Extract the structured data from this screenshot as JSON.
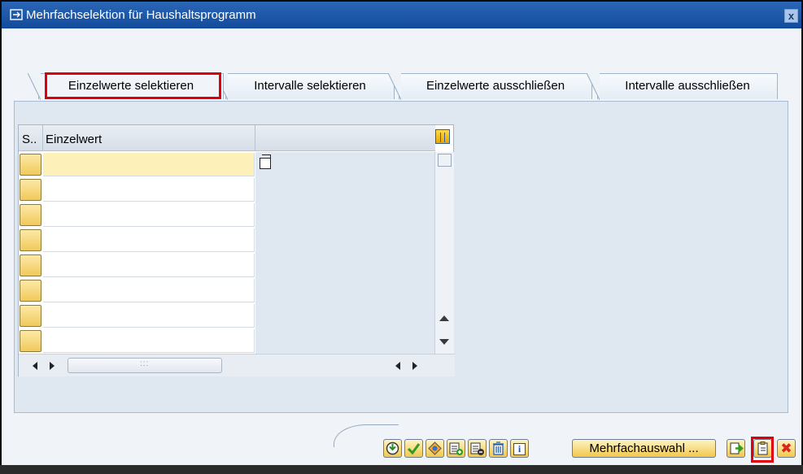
{
  "window": {
    "title": "Mehrfachselektion für Haushaltsprogramm",
    "close_label": "x"
  },
  "tabs": [
    {
      "label": "Einzelwerte selektieren",
      "active": true
    },
    {
      "label": "Intervalle selektieren",
      "active": false
    },
    {
      "label": "Einzelwerte ausschließen",
      "active": false
    },
    {
      "label": "Intervalle ausschließen",
      "active": false
    }
  ],
  "table": {
    "columns": [
      "S..",
      "Einzelwert"
    ],
    "rows": [
      "",
      "",
      "",
      "",
      "",
      "",
      "",
      ""
    ]
  },
  "toolbar": {
    "execute_icon": "execute-icon",
    "confirm_icon": "check-icon",
    "range_icon": "range-icon",
    "insert_row_icon": "insert-row-icon",
    "delete_row_icon": "delete-row-icon",
    "delete_all_icon": "trash-icon",
    "info_label": "i",
    "multi_select_label": "Mehrfachauswahl ...",
    "import_icon": "import-icon",
    "clipboard_icon": "clipboard-upload-icon",
    "cancel_label": "✖"
  },
  "colors": {
    "title_bar": "#1a54a8",
    "highlight": "#e0000b",
    "selected_cell": "#fdf0b8",
    "button_yellow": "#f1c84e"
  }
}
